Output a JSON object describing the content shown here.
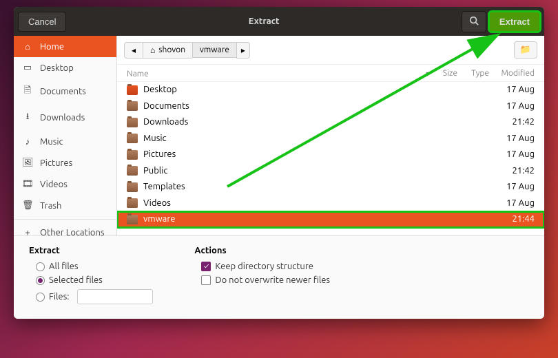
{
  "titlebar": {
    "cancel": "Cancel",
    "title": "Extract",
    "extract": "Extract"
  },
  "sidebar": {
    "items": [
      {
        "label": "Home"
      },
      {
        "label": "Desktop"
      },
      {
        "label": "Documents"
      },
      {
        "label": "Downloads"
      },
      {
        "label": "Music"
      },
      {
        "label": "Pictures"
      },
      {
        "label": "Videos"
      },
      {
        "label": "Trash"
      }
    ],
    "other": "Other Locations"
  },
  "path": {
    "seg1": "shovon",
    "seg2": "vmware"
  },
  "columns": {
    "name": "Name",
    "size": "Size",
    "type": "Type",
    "modified": "Modified"
  },
  "files": [
    {
      "name": "Desktop",
      "modified": "17 Aug"
    },
    {
      "name": "Documents",
      "modified": "17 Aug"
    },
    {
      "name": "Downloads",
      "modified": "21:42"
    },
    {
      "name": "Music",
      "modified": "17 Aug"
    },
    {
      "name": "Pictures",
      "modified": "17 Aug"
    },
    {
      "name": "Public",
      "modified": "21:42"
    },
    {
      "name": "Templates",
      "modified": "17 Aug"
    },
    {
      "name": "Videos",
      "modified": "17 Aug"
    },
    {
      "name": "vmware",
      "modified": "21:44"
    }
  ],
  "bottom": {
    "extract_heading": "Extract",
    "all_files": "All files",
    "selected_files": "Selected files",
    "files": "Files:",
    "actions_heading": "Actions",
    "keep_structure": "Keep directory structure",
    "no_overwrite": "Do not overwrite newer files"
  }
}
